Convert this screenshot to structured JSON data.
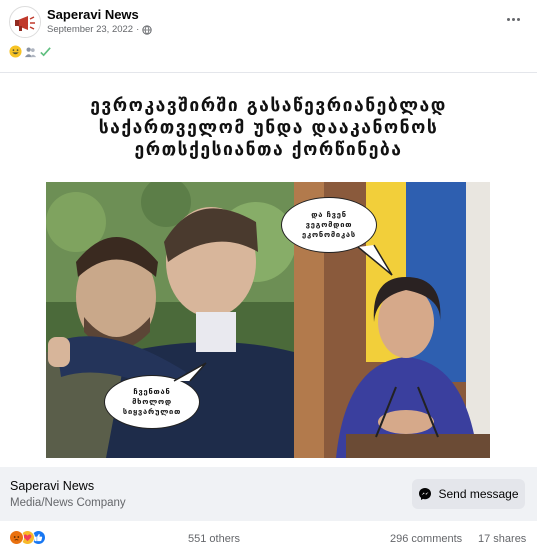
{
  "post": {
    "page_name": "Saperavi News",
    "date": "September 23, 2022",
    "separator": " · ",
    "header_emojis": [
      "grinning-face-icon",
      "people-icon",
      "check-mark-icon"
    ]
  },
  "image": {
    "headline_lines": [
      "ევროკავშირში გასაწევრიანებლად",
      "საქართველომ უნდა დააკანონოს",
      "ერთსქესიანთა ქორწინება"
    ],
    "bubble_top": "და ჩვენ ვეგომდით ეკონომიკას",
    "bubble_bottom": "ჩვენთან მხოლოდ სიყვარულით"
  },
  "page_card": {
    "name": "Saperavi News",
    "category": "Media/News Company",
    "send_label": "Send message"
  },
  "footer": {
    "reactions": [
      "angry-icon",
      "love-icon",
      "like-icon"
    ],
    "others": "551 others",
    "comments": "296 comments",
    "shares": "17 shares"
  },
  "colors": {
    "like": "#1877f2",
    "love": "#f33e58",
    "angry": "#e9710f",
    "muted": "#65676b"
  }
}
